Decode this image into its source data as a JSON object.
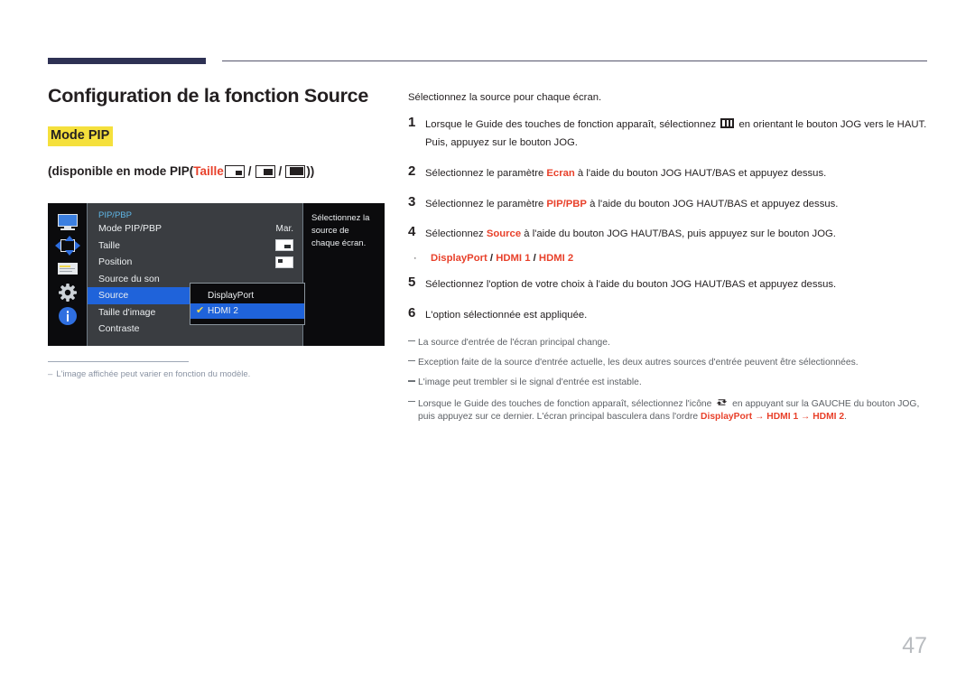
{
  "page": {
    "number": "47"
  },
  "heading": {
    "title": "Configuration de la fonction Source",
    "badge": "Mode PIP",
    "availability_prefix": "(disponible en mode PIP(",
    "availability_taille": "Taille",
    "availability_suffix": "))",
    "slash": "/"
  },
  "osd": {
    "title": "PIP/PBP",
    "rows": [
      {
        "label": "Mode PIP/PBP",
        "value": "Mar.",
        "icon": "none",
        "selected": false
      },
      {
        "label": "Taille",
        "value": "",
        "icon": "pip-size-small",
        "selected": false
      },
      {
        "label": "Position",
        "value": "",
        "icon": "pip-position",
        "selected": false
      },
      {
        "label": "Source du son",
        "value": "",
        "icon": "none",
        "selected": false
      },
      {
        "label": "Source",
        "value": "",
        "icon": "none",
        "selected": true
      },
      {
        "label": "Taille d'image",
        "value": "",
        "icon": "none",
        "selected": false
      },
      {
        "label": "Contraste",
        "value": "",
        "icon": "none",
        "selected": false
      }
    ],
    "submenu": [
      {
        "label": "DisplayPort",
        "checked": false,
        "selected": false
      },
      {
        "label": "HDMI 2",
        "checked": true,
        "selected": true
      }
    ],
    "check_glyph": "✔",
    "help_text": "Sélectionnez la source de chaque écran.",
    "sidebar_icons": [
      "monitor-icon",
      "position-move-icon",
      "osd-list-icon",
      "gear-icon",
      "info-icon"
    ]
  },
  "figure_note": {
    "dash": "‒",
    "text": "L'image affichée peut varier en fonction du modèle."
  },
  "instructions": {
    "intro": "Sélectionnez la source pour chaque écran.",
    "steps": [
      {
        "num": "1",
        "parts": [
          {
            "t": "Lorsque le Guide des touches de fonction apparaît, sélectionnez ",
            "s": "n"
          },
          {
            "t": "MENU-ICON",
            "s": "icon-menu"
          },
          {
            "t": " en orientant le bouton JOG vers le HAUT. Puis, appuyez sur le bouton JOG.",
            "s": "n"
          }
        ]
      },
      {
        "num": "2",
        "parts": [
          {
            "t": "Sélectionnez le paramètre ",
            "s": "n"
          },
          {
            "t": "Ecran",
            "s": "rb"
          },
          {
            "t": " à l'aide du bouton JOG HAUT/BAS et appuyez dessus.",
            "s": "n"
          }
        ]
      },
      {
        "num": "3",
        "parts": [
          {
            "t": "Sélectionnez le paramètre ",
            "s": "n"
          },
          {
            "t": "PIP/PBP",
            "s": "rb"
          },
          {
            "t": " à l'aide du bouton JOG HAUT/BAS et appuyez dessus.",
            "s": "n"
          }
        ]
      },
      {
        "num": "4",
        "parts": [
          {
            "t": "Sélectionnez ",
            "s": "n"
          },
          {
            "t": "Source",
            "s": "rb"
          },
          {
            "t": " à l'aide du bouton JOG HAUT/BAS, puis appuyez sur le bouton JOG.",
            "s": "n"
          }
        ]
      }
    ],
    "bullet": {
      "marker": "·",
      "parts": [
        {
          "t": "DisplayPort",
          "s": "rb"
        },
        {
          "t": " / ",
          "s": "b"
        },
        {
          "t": "HDMI 1",
          "s": "rb"
        },
        {
          "t": " / ",
          "s": "b"
        },
        {
          "t": "HDMI 2",
          "s": "rb"
        }
      ]
    },
    "steps_after": [
      {
        "num": "5",
        "parts": [
          {
            "t": "Sélectionnez l'option de votre choix à l'aide du bouton JOG HAUT/BAS et appuyez dessus.",
            "s": "n"
          }
        ]
      },
      {
        "num": "6",
        "parts": [
          {
            "t": "L'option sélectionnée est appliquée.",
            "s": "n"
          }
        ]
      }
    ],
    "notes": [
      {
        "parts": [
          {
            "t": "La source d'entrée de l'écran principal change.",
            "s": "n"
          }
        ]
      },
      {
        "parts": [
          {
            "t": "Exception faite de la source d'entrée actuelle, les deux autres sources d'entrée peuvent être sélectionnées.",
            "s": "n"
          }
        ]
      },
      {
        "parts": [
          {
            "t": "L'image peut trembler si le signal d'entrée est instable.",
            "s": "n"
          }
        ]
      },
      {
        "parts": [
          {
            "t": "Lorsque le Guide des touches de fonction apparaît, sélectionnez l'icône ",
            "s": "n"
          },
          {
            "t": "SWAP-ICON",
            "s": "icon-swap"
          },
          {
            "t": " en appuyant sur la GAUCHE du bouton JOG, puis appuyez sur ce dernier. L'écran principal basculera dans l'ordre ",
            "s": "n"
          },
          {
            "t": "DisplayPort",
            "s": "rb"
          },
          {
            "t": " → ",
            "s": "rb"
          },
          {
            "t": "HDMI 1",
            "s": "rb"
          },
          {
            "t": " → ",
            "s": "rb"
          },
          {
            "t": "HDMI 2",
            "s": "rb"
          },
          {
            "t": ".",
            "s": "n"
          }
        ]
      }
    ]
  },
  "colors": {
    "accent_red": "#e8412b",
    "badge_yellow": "#f5e03c",
    "rule_navy": "#2e3154",
    "osd_select_blue": "#1f63da",
    "osd_title_blue": "#5fb7e8"
  }
}
